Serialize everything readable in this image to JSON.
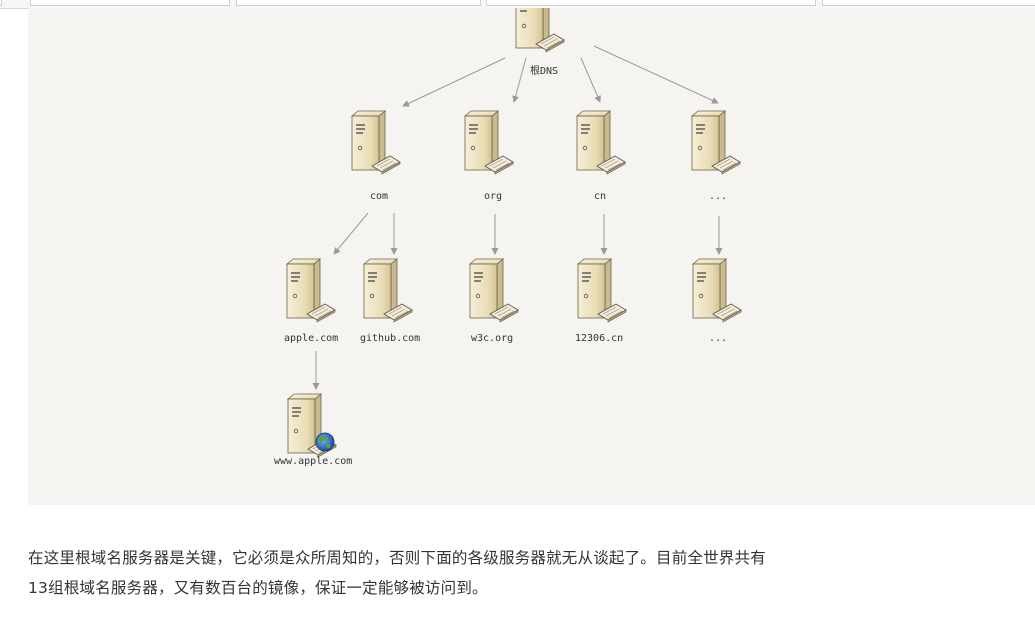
{
  "tabs": [
    {
      "label": ""
    },
    {
      "label": ""
    },
    {
      "label": ""
    },
    {
      "label": ""
    },
    {
      "label": ""
    }
  ],
  "diagram": {
    "root_label": "根DNS",
    "tld": [
      {
        "label": "com"
      },
      {
        "label": "org"
      },
      {
        "label": "cn"
      },
      {
        "label": "..."
      }
    ],
    "second_level": [
      {
        "label": "apple.com"
      },
      {
        "label": "github.com"
      },
      {
        "label": "w3c.org"
      },
      {
        "label": "12306.cn"
      },
      {
        "label": "..."
      }
    ],
    "third_level": [
      {
        "label": "www.apple.com"
      }
    ]
  },
  "paragraph": {
    "line1": "在这里根域名服务器是关键，它必须是众所周知的，否则下面的各级服务器就无从谈起了。目前全世界共有",
    "line2": "13组根域名服务器，又有数百台的镜像，保证一定能够被访问到。"
  },
  "colors": {
    "background": "#f5f4f1",
    "server_body": "#ede4c6",
    "server_shade": "#c9bb8d",
    "arrow": "#9a9a9a",
    "text": "#333333"
  }
}
